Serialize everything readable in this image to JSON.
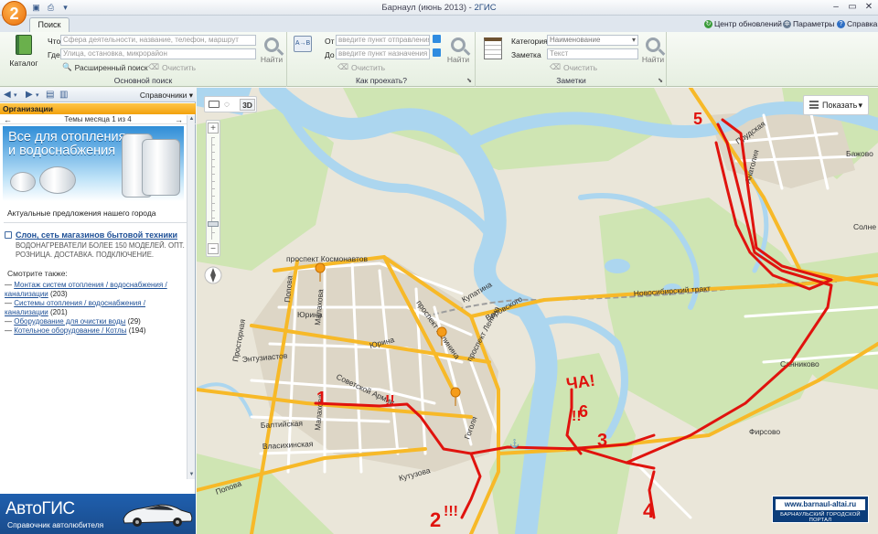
{
  "window": {
    "logo": "2",
    "title": "Барнаул (июнь 2013)",
    "app": "2ГИС",
    "sep": " - "
  },
  "tabs": {
    "search": "Поиск"
  },
  "toplinks": {
    "updates": "Центр обновлений",
    "params": "Параметры",
    "help": "Справка"
  },
  "ribbon": {
    "basic": {
      "title": "Основной поиск",
      "catalog": "Каталог",
      "what_label": "Что",
      "what_placeholder": "Сфера деятельности, название, телефон, маршрут",
      "where_label": "Где",
      "where_placeholder": "Улица, остановка, микрорайон",
      "find": "Найти",
      "advanced": "Расширенный поиск",
      "clear": "Очистить"
    },
    "route": {
      "title": "Как проехать?",
      "from_label": "От",
      "from_placeholder": "введите пункт отправления",
      "to_label": "До",
      "to_placeholder": "введите пункт назначения",
      "find": "Найти",
      "clear": "Очистить"
    },
    "notes": {
      "title": "Заметки",
      "category_label": "Категория",
      "category_value": "Наименование",
      "note_label": "Заметка",
      "note_placeholder": "Текст",
      "find": "Найти",
      "clear": "Очистить"
    }
  },
  "left": {
    "directories": "Справочники",
    "section": "Организации",
    "themes": "Темы месяца 1 из 4",
    "banner": "Все для отопления и водоснабжения",
    "actual": "Актуальные предложения нашего города",
    "org": {
      "name": "Слон, сеть магазинов бытовой техники",
      "desc1": "ВОДОНАГРЕВАТЕЛИ БОЛЕЕ 150 МОДЕЛЕЙ. ОПТ.",
      "desc2": "РОЗНИЦА. ДОСТАВКА. ПОДКЛЮЧЕНИЕ."
    },
    "seealso": "Смотрите также:",
    "links": [
      {
        "l1": "Монтаж систем отопления / водоснабжения /",
        "l2": "канализации",
        "count": "(203)"
      },
      {
        "l1": "Системы отопления / водоснабжения /",
        "l2": "канализации",
        "count": "(201)"
      },
      {
        "l1": "Оборудование для очистки воды",
        "l2": "",
        "count": "(29)"
      },
      {
        "l1": "Котельное оборудование / Котлы",
        "l2": "",
        "count": "(194)"
      }
    ],
    "ad": {
      "title": "АвтоГИС",
      "subtitle": "Справочник автолюбителя"
    }
  },
  "map": {
    "tool3d": "3D",
    "show": "Показать",
    "portal": {
      "url": "www.barnaul-altai.ru",
      "sub": "БАРНАУЛЬСКИЙ ГОРОДСКОЙ ПОРТАЛ"
    },
    "streets": {
      "kosmonavtov": "проспект Космонавтов",
      "kalinina": "проспект Калинина",
      "kupatina": "Купатина",
      "vorovskogo": "Воровского",
      "lenina": "проспект Ленина",
      "yurina": "Юрина",
      "yurina2": "Юрина",
      "sov_armii": "Советской Армии",
      "entuziastov": "Энтузиастов",
      "prostornaya": "Просторная",
      "malakhova": "Малахова",
      "malakhova2": "Малахова",
      "polzunova": "Попова",
      "baltiyskaya": "Балтийская",
      "vlasikhinskaya": "Власихинская",
      "popova2": "Попова",
      "kutuzova": "Кутузова",
      "gogolya": "Гоголя",
      "novosib": "Новосибирский тракт",
      "prudskaya": "Прудская",
      "anatoliya": "Анатолия",
      "solne": "Солне",
      "bazhovo": "Бажово",
      "sannikovo": "Санниково",
      "firsovo": "Фирсово"
    },
    "annotations": {
      "n1": "1",
      "n2": "2",
      "n3": "3",
      "n4": "4",
      "n5": "5",
      "n6": "6",
      "cha": "ЧА!",
      "excl1": "!!",
      "excl2": "!!!",
      "excl3": "!!"
    },
    "colors": {
      "water": "#acd6ef",
      "land": "#eae6d9",
      "green": "#cfe5b3",
      "arterial": "#f7b928",
      "track": "#e0130e"
    }
  }
}
